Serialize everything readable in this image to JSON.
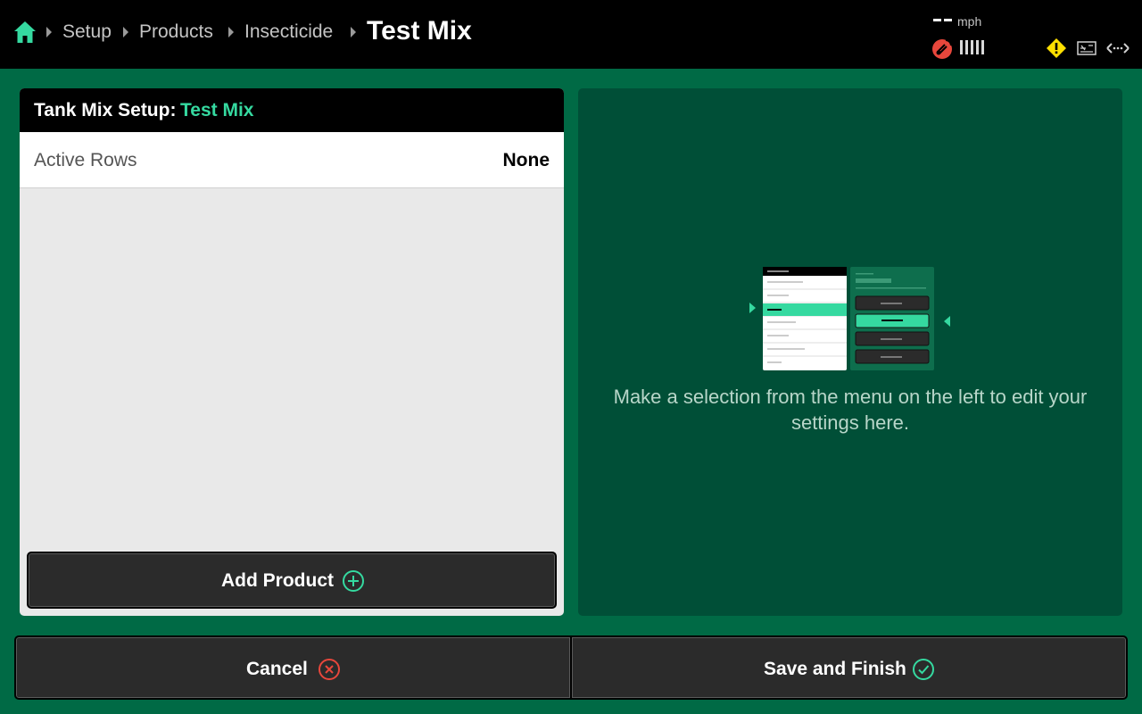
{
  "header": {
    "breadcrumbs": [
      "Setup",
      "Products",
      "Insecticide"
    ],
    "current_page": "Test Mix",
    "speed_value": "--",
    "speed_unit": "mph",
    "status_icons": [
      "home-icon",
      "gps-signal-icon",
      "signal-strength-icon",
      "warning-icon",
      "implement-icon",
      "width-icon"
    ]
  },
  "left_panel": {
    "title_prefix": "Tank Mix Setup:",
    "title_name": "Test Mix",
    "active_rows_label": "Active Rows",
    "active_rows_value": "None",
    "add_product_label": "Add Product"
  },
  "right_panel": {
    "hint": "Make a selection from the menu on the left to edit your settings here."
  },
  "footer": {
    "cancel_label": "Cancel",
    "save_label": "Save and Finish"
  },
  "colors": {
    "background": "#006a45",
    "panel_dark": "#004f37",
    "accent": "#35d9a0",
    "cancel_red": "#e8473c",
    "warning_yellow": "#ffe000"
  }
}
